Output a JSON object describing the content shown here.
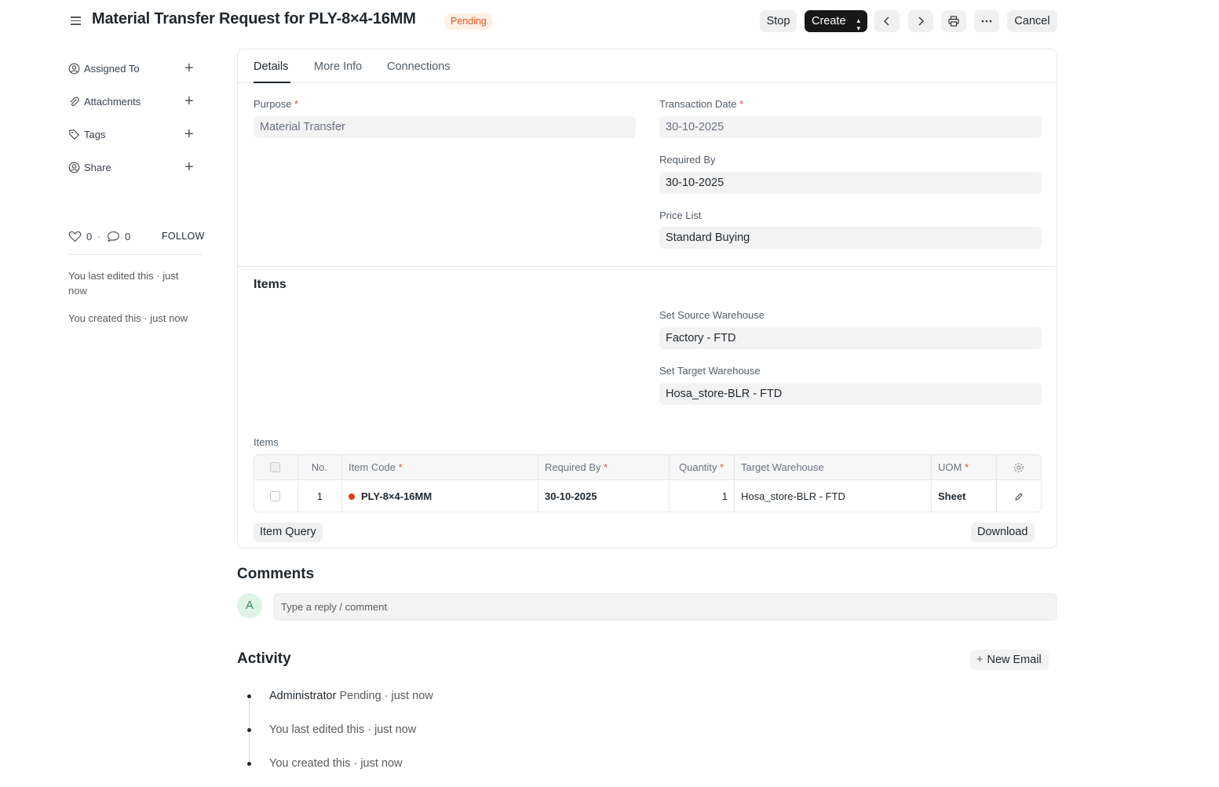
{
  "header": {
    "title": "Material Transfer Request for PLY-8×4-16MM",
    "status": "Pending",
    "buttons": {
      "stop": "Stop",
      "create": "Create",
      "cancel": "Cancel"
    }
  },
  "sidebar": {
    "items": [
      {
        "label": "Assigned To",
        "icon": "assign-icon"
      },
      {
        "label": "Attachments",
        "icon": "paperclip-icon"
      },
      {
        "label": "Tags",
        "icon": "tag-icon"
      },
      {
        "label": "Share",
        "icon": "share-icon"
      }
    ],
    "likes": "0",
    "comments": "0",
    "follow_label": "FOLLOW",
    "last_edited": "You last edited this · just now",
    "created": "You created this · just now"
  },
  "tabs": [
    "Details",
    "More Info",
    "Connections"
  ],
  "details": {
    "purpose": {
      "label": "Purpose",
      "value": "Material Transfer"
    },
    "transaction_date": {
      "label": "Transaction Date",
      "value": "30-10-2025"
    },
    "required_by": {
      "label": "Required By",
      "value": "30-10-2025"
    },
    "price_list": {
      "label": "Price List",
      "value": "Standard Buying"
    }
  },
  "items_section": {
    "title": "Items",
    "source_warehouse": {
      "label": "Set Source Warehouse",
      "value": "Factory - FTD"
    },
    "target_warehouse": {
      "label": "Set Target Warehouse",
      "value": "Hosa_store-BLR - FTD"
    },
    "table_label": "Items",
    "columns": [
      "No.",
      "Item Code",
      "Required By",
      "Quantity",
      "Target Warehouse",
      "UOM"
    ],
    "rows": [
      {
        "no": "1",
        "item_code": "PLY-8×4-16MM",
        "required_by": "30-10-2025",
        "quantity": "1",
        "target_warehouse": "Hosa_store-BLR - FTD",
        "uom": "Sheet"
      }
    ],
    "item_query_label": "Item Query",
    "download_label": "Download"
  },
  "comments": {
    "title": "Comments",
    "avatar_initial": "A",
    "placeholder": "Type a reply / comment"
  },
  "activity": {
    "title": "Activity",
    "new_email_label": "New Email",
    "entries": [
      {
        "who": "Administrator",
        "text": "Pending · just now"
      },
      {
        "who": "",
        "text": "You last edited this · just now"
      },
      {
        "who": "",
        "text": "You created this · just now"
      }
    ]
  },
  "colors": {
    "status_bg": "#fff0e6",
    "status_text": "#e2581b",
    "primary_button": "#171717",
    "indicator_red": "#d9400f",
    "avatar_bg": "#dff3e6",
    "avatar_text": "#2f8f58"
  }
}
